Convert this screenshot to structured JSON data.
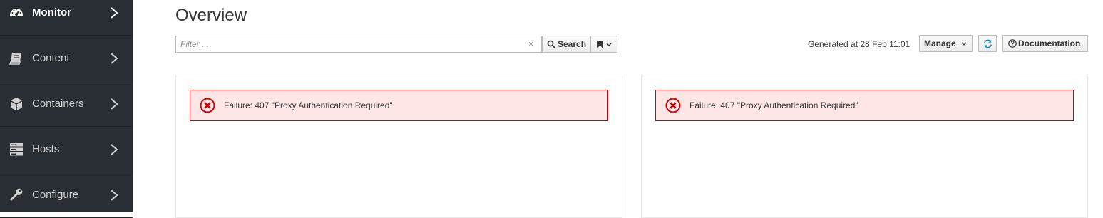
{
  "sidebar": {
    "items": [
      {
        "label": "Monitor",
        "icon": "dashboard-icon",
        "active": true
      },
      {
        "label": "Content",
        "icon": "book-icon",
        "active": false
      },
      {
        "label": "Containers",
        "icon": "cube-icon",
        "active": false
      },
      {
        "label": "Hosts",
        "icon": "server-icon",
        "active": false
      },
      {
        "label": "Configure",
        "icon": "wrench-icon",
        "active": false
      }
    ]
  },
  "page": {
    "title": "Overview"
  },
  "toolbar": {
    "filter_placeholder": "Filter ...",
    "clear_label": "×",
    "search_label": "Search",
    "generated_text": "Generated at 28 Feb 11:01",
    "manage_label": "Manage",
    "documentation_label": "Documentation"
  },
  "widgets": [
    {
      "alert": "Failure: 407 \"Proxy Authentication Required\""
    },
    {
      "alert": "Failure: 407 \"Proxy Authentication Required\""
    }
  ],
  "colors": {
    "sidebar_bg": "#292e34",
    "alert_border": "#cc0000",
    "alert_bg": "#ffe6e6",
    "alert_icon": "#cc0000",
    "refresh_icon": "#0088ce"
  }
}
